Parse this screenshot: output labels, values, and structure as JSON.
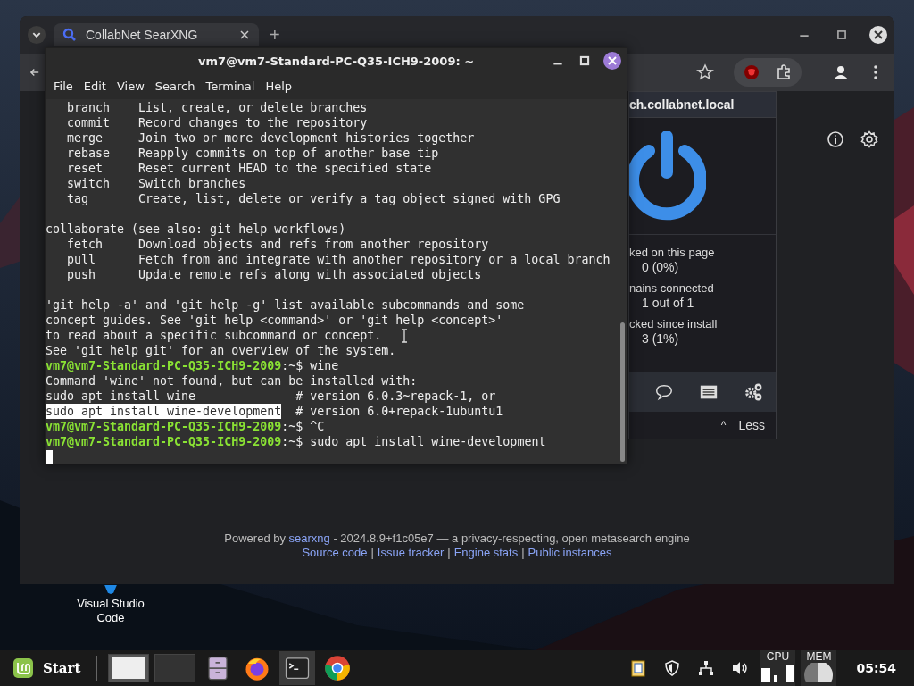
{
  "desktop": {
    "icons": [
      {
        "label": "Visual Studio Code"
      }
    ]
  },
  "browser": {
    "tabs": [
      {
        "title": "CollabNet SearXNG",
        "selected": true
      }
    ],
    "new_tab": "+",
    "footer": {
      "prefix": "Powered by",
      "link": "searxng",
      "suffix": "- 2024.8.9+f1c05e7 — a privacy-respecting, open metasearch engine",
      "separator": "|",
      "links": [
        "Source code",
        "Issue tracker",
        "Engine stats",
        "Public instances"
      ]
    }
  },
  "blocker_popup": {
    "domain": "ch.collabnet.local",
    "enabled": true,
    "stats": [
      {
        "label": "ked on this page",
        "value": "0 (0%)"
      },
      {
        "label": "nains connected",
        "value": "1 out of 1"
      },
      {
        "label": "cked since install",
        "value": "3 (1%)"
      }
    ],
    "toggle": {
      "caret": "^",
      "label": "Less"
    }
  },
  "terminal": {
    "title": "vm7@vm7-Standard-PC-Q35-ICH9-2009: ~",
    "menu": [
      "File",
      "Edit",
      "View",
      "Search",
      "Terminal",
      "Help"
    ],
    "lines": [
      {
        "kind": "output",
        "text": "   branch    List, create, or delete branches"
      },
      {
        "kind": "output",
        "text": "   commit    Record changes to the repository"
      },
      {
        "kind": "output",
        "text": "   merge     Join two or more development histories together"
      },
      {
        "kind": "output",
        "text": "   rebase    Reapply commits on top of another base tip"
      },
      {
        "kind": "output",
        "text": "   reset     Reset current HEAD to the specified state"
      },
      {
        "kind": "output",
        "text": "   switch    Switch branches"
      },
      {
        "kind": "output",
        "text": "   tag       Create, list, delete or verify a tag object signed with GPG"
      },
      {
        "kind": "blank"
      },
      {
        "kind": "output",
        "text": "collaborate (see also: git help workflows)"
      },
      {
        "kind": "output",
        "text": "   fetch     Download objects and refs from another repository"
      },
      {
        "kind": "output",
        "text": "   pull      Fetch from and integrate with another repository or a local branch"
      },
      {
        "kind": "output",
        "text": "   push      Update remote refs along with associated objects"
      },
      {
        "kind": "blank"
      },
      {
        "kind": "output",
        "text": "'git help -a' and 'git help -g' list available subcommands and some"
      },
      {
        "kind": "output",
        "text": "concept guides. See 'git help <command>' or 'git help <concept>'"
      },
      {
        "kind": "output",
        "text": "to read about a specific subcommand or concept."
      },
      {
        "kind": "output",
        "text": "See 'git help git' for an overview of the system."
      },
      {
        "kind": "prompt",
        "host": "vm7@vm7-Standard-PC-Q35-ICH9-2009",
        "path": ":~$",
        "text": "wine"
      },
      {
        "kind": "output",
        "text": "Command 'wine' not found, but can be installed with:"
      },
      {
        "kind": "output",
        "text": "sudo apt install wine              # version 6.0.3~repack-1, or"
      },
      {
        "kind": "selection",
        "text": "sudo apt install wine-development",
        "rest": "  # version 6.0+repack-1ubuntu1"
      },
      {
        "kind": "prompt",
        "host": "vm7@vm7-Standard-PC-Q35-ICH9-2009",
        "path": ":~$",
        "text": "^C"
      },
      {
        "kind": "prompt",
        "host": "vm7@vm7-Standard-PC-Q35-ICH9-2009",
        "path": ":~$",
        "text": "sudo apt install wine-development"
      },
      {
        "kind": "cursor"
      }
    ]
  },
  "taskbar": {
    "start": "Start",
    "cpu": "CPU",
    "mem": "MEM",
    "clock": "05:54"
  }
}
